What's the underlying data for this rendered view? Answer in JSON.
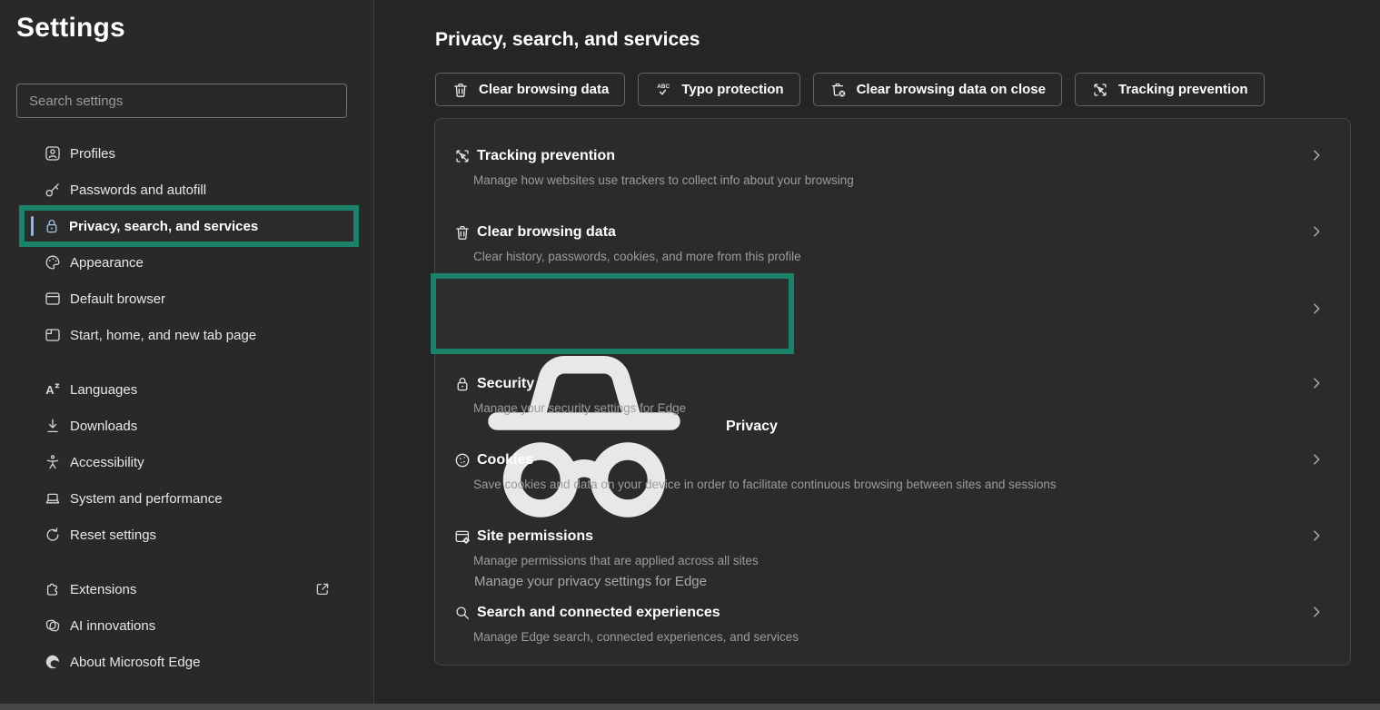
{
  "app": {
    "title": "Settings"
  },
  "theme": {
    "annotation_highlight_color": "#1B8168",
    "selected_accent_color": "#9AB4D6",
    "background": "#252525"
  },
  "sidebar": {
    "search": {
      "placeholder": "Search settings"
    },
    "items": [
      {
        "label": "Profiles",
        "icon": "profile-card-icon"
      },
      {
        "label": "Passwords and autofill",
        "icon": "key-icon"
      },
      {
        "label": "Privacy, search, and services",
        "icon": "lock-icon",
        "selected": true,
        "highlighted": true
      },
      {
        "label": "Appearance",
        "icon": "palette-icon"
      },
      {
        "label": "Default browser",
        "icon": "browser-window-icon"
      },
      {
        "label": "Start, home, and new tab page",
        "icon": "new-tab-icon"
      },
      {
        "label": "Languages",
        "icon": "translate-icon"
      },
      {
        "label": "Downloads",
        "icon": "download-icon"
      },
      {
        "label": "Accessibility",
        "icon": "accessibility-icon"
      },
      {
        "label": "System and performance",
        "icon": "laptop-icon"
      },
      {
        "label": "Reset settings",
        "icon": "reset-icon"
      },
      {
        "label": "Extensions",
        "icon": "puzzle-icon",
        "external_link": true
      },
      {
        "label": "AI innovations",
        "icon": "ai-icon"
      },
      {
        "label": "About Microsoft Edge",
        "icon": "edge-logo-icon"
      }
    ]
  },
  "main": {
    "title": "Privacy, search, and services",
    "quick_actions": [
      {
        "label": "Clear browsing data",
        "icon": "trash-icon"
      },
      {
        "label": "Typo protection",
        "icon": "abc-check-icon"
      },
      {
        "label": "Clear browsing data on close",
        "icon": "trash-close-icon"
      },
      {
        "label": "Tracking prevention",
        "icon": "tracking-prevention-icon"
      }
    ],
    "settings_list": [
      {
        "title": "Tracking prevention",
        "description": "Manage how websites use trackers to collect info about your browsing",
        "icon": "tracking-prevention-icon"
      },
      {
        "title": "Clear browsing data",
        "description": "Clear history, passwords, cookies, and more from this profile",
        "icon": "trash-icon"
      },
      {
        "title": "Privacy",
        "description": "Manage your privacy settings for Edge",
        "icon": "incognito-icon",
        "highlighted": true
      },
      {
        "title": "Security",
        "description": "Manage your security settings for Edge",
        "icon": "lock-icon"
      },
      {
        "title": "Cookies",
        "description": "Save cookies and data on your device in order to facilitate continuous browsing between sites and sessions",
        "icon": "cookie-icon"
      },
      {
        "title": "Site permissions",
        "description": "Manage permissions that are applied across all sites",
        "icon": "site-permissions-icon"
      },
      {
        "title": "Search and connected experiences",
        "description": "Manage Edge search, connected experiences, and services",
        "icon": "search-icon"
      }
    ]
  }
}
